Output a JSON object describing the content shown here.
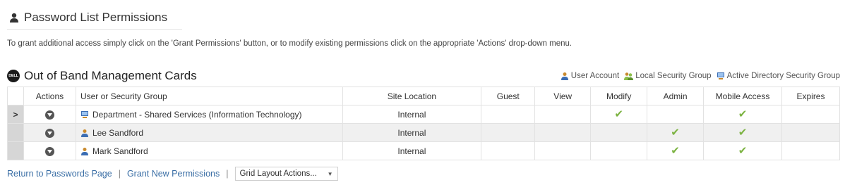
{
  "page": {
    "title": "Password List Permissions",
    "intro": "To grant additional access simply click on the 'Grant Permissions' button, or to modify existing permissions click on the appropriate 'Actions' drop-down menu."
  },
  "section": {
    "logo_text": "DELL",
    "title": "Out of Band Management Cards",
    "legend": {
      "user_account": "User Account",
      "local_group": "Local Security Group",
      "ad_group": "Active Directory Security Group"
    }
  },
  "grid": {
    "columns": {
      "actions": "Actions",
      "user": "User or Security Group",
      "site": "Site Location",
      "guest": "Guest",
      "view": "View",
      "modify": "Modify",
      "admin": "Admin",
      "mobile": "Mobile Access",
      "expires": "Expires"
    },
    "rows": [
      {
        "selector": ">",
        "type": "ad-group",
        "name": "Department - Shared Services (Information Technology)",
        "site": "Internal",
        "guest": "",
        "view": "",
        "modify": "✔",
        "admin": "",
        "mobile": "✔",
        "expires": ""
      },
      {
        "selector": "",
        "type": "user",
        "name": "Lee Sandford",
        "site": "Internal",
        "guest": "",
        "view": "",
        "modify": "",
        "admin": "✔",
        "mobile": "✔",
        "expires": ""
      },
      {
        "selector": "",
        "type": "user",
        "name": "Mark Sandford",
        "site": "Internal",
        "guest": "",
        "view": "",
        "modify": "",
        "admin": "✔",
        "mobile": "✔",
        "expires": ""
      }
    ]
  },
  "footer": {
    "return_link": "Return to Passwords Page",
    "grant_link": "Grant New Permissions",
    "sep": "|",
    "grid_actions": "Grid Layout Actions..."
  },
  "colors": {
    "check": "#7cb342",
    "link": "#3a6ea5",
    "selector_bg": "#d6d6d6"
  }
}
